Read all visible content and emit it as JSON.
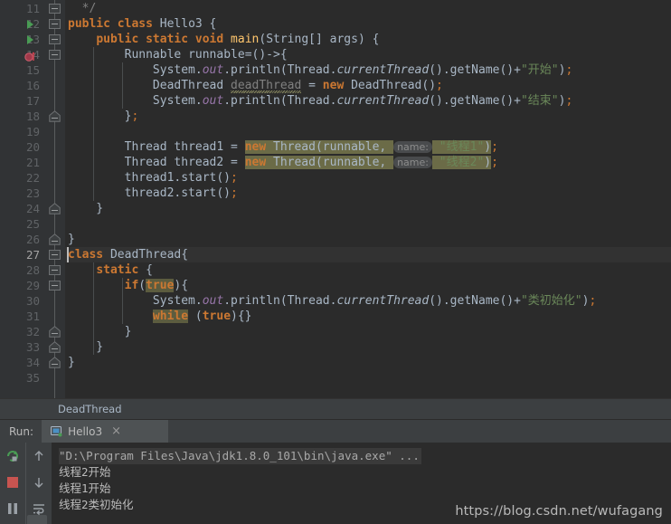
{
  "editor": {
    "first_line": 11,
    "caret_line": 27,
    "lines": [
      {
        "num": 11,
        "indent_guides": 0,
        "fold": "box",
        "tokens": [
          {
            "t": "  ",
            "c": "plain"
          },
          {
            "t": "*/",
            "c": "cmt"
          }
        ]
      },
      {
        "num": 12,
        "gutter": "run-arrow",
        "fold": "box",
        "tokens": [
          {
            "t": "public",
            "c": "kw"
          },
          {
            "t": " ",
            "c": "plain"
          },
          {
            "t": "class",
            "c": "kw"
          },
          {
            "t": " ",
            "c": "plain"
          },
          {
            "t": "Hello3",
            "c": "cls"
          },
          {
            "t": " {",
            "c": "plain"
          }
        ]
      },
      {
        "num": 13,
        "gutter": "run-arrow",
        "fold": "box",
        "tokens": [
          {
            "t": "    ",
            "c": "plain"
          },
          {
            "t": "public",
            "c": "kw"
          },
          {
            "t": " ",
            "c": "plain"
          },
          {
            "t": "static",
            "c": "kw"
          },
          {
            "t": " ",
            "c": "plain"
          },
          {
            "t": "void",
            "c": "kw"
          },
          {
            "t": " ",
            "c": "plain"
          },
          {
            "t": "main",
            "c": "meth"
          },
          {
            "t": "(",
            "c": "plain"
          },
          {
            "t": "String",
            "c": "cls"
          },
          {
            "t": "[] args) {",
            "c": "plain"
          }
        ]
      },
      {
        "num": 14,
        "gutter": "lambda",
        "fold": "box",
        "tokens": [
          {
            "t": "        ",
            "c": "plain"
          },
          {
            "t": "Runnable",
            "c": "cls"
          },
          {
            "t": " runnable=()->{",
            "c": "plain"
          }
        ]
      },
      {
        "num": 15,
        "tokens": [
          {
            "t": "            ",
            "c": "plain"
          },
          {
            "t": "System",
            "c": "cls"
          },
          {
            "t": ".",
            "c": "plain"
          },
          {
            "t": "out",
            "c": "fld"
          },
          {
            "t": ".println(",
            "c": "plain"
          },
          {
            "t": "Thread",
            "c": "cls"
          },
          {
            "t": ".",
            "c": "plain"
          },
          {
            "t": "currentThread",
            "c": "stat"
          },
          {
            "t": "().getName()+",
            "c": "plain"
          },
          {
            "t": "\"开始\"",
            "c": "str"
          },
          {
            "t": ")",
            "c": "plain"
          },
          {
            "t": ";",
            "c": "semi"
          }
        ]
      },
      {
        "num": 16,
        "tokens": [
          {
            "t": "            ",
            "c": "plain"
          },
          {
            "t": "DeadThread",
            "c": "cls"
          },
          {
            "t": " ",
            "c": "plain"
          },
          {
            "t": "deadThread",
            "c": "unused"
          },
          {
            "t": " = ",
            "c": "plain"
          },
          {
            "t": "new",
            "c": "kw"
          },
          {
            "t": " ",
            "c": "plain"
          },
          {
            "t": "DeadThread",
            "c": "cls"
          },
          {
            "t": "()",
            "c": "plain"
          },
          {
            "t": ";",
            "c": "semi"
          }
        ]
      },
      {
        "num": 17,
        "tokens": [
          {
            "t": "            ",
            "c": "plain"
          },
          {
            "t": "System",
            "c": "cls"
          },
          {
            "t": ".",
            "c": "plain"
          },
          {
            "t": "out",
            "c": "fld"
          },
          {
            "t": ".println(",
            "c": "plain"
          },
          {
            "t": "Thread",
            "c": "cls"
          },
          {
            "t": ".",
            "c": "plain"
          },
          {
            "t": "currentThread",
            "c": "stat"
          },
          {
            "t": "().getName()+",
            "c": "plain"
          },
          {
            "t": "\"结束\"",
            "c": "str"
          },
          {
            "t": ")",
            "c": "plain"
          },
          {
            "t": ";",
            "c": "semi"
          }
        ]
      },
      {
        "num": 18,
        "fold": "arrow-up",
        "tokens": [
          {
            "t": "        }",
            "c": "plain"
          },
          {
            "t": ";",
            "c": "semi"
          }
        ]
      },
      {
        "num": 19,
        "tokens": []
      },
      {
        "num": 20,
        "tokens": [
          {
            "t": "        ",
            "c": "plain"
          },
          {
            "t": "Thread",
            "c": "cls"
          },
          {
            "t": " thread1 = ",
            "c": "plain"
          },
          {
            "t": "new",
            "c": "hl-new-kw"
          },
          {
            "t": " Thread(runnable, ",
            "c": "hl-new-plain"
          },
          {
            "t": "name:",
            "c": "hint"
          },
          {
            "t": " ",
            "c": "hl-new-plain"
          },
          {
            "t": "\"线程1\"",
            "c": "hl-new-str"
          },
          {
            "t": ")",
            "c": "hl-new-plain"
          },
          {
            "t": ";",
            "c": "semi"
          }
        ]
      },
      {
        "num": 21,
        "tokens": [
          {
            "t": "        ",
            "c": "plain"
          },
          {
            "t": "Thread",
            "c": "cls"
          },
          {
            "t": " thread2 = ",
            "c": "plain"
          },
          {
            "t": "new",
            "c": "hl-new-kw"
          },
          {
            "t": " Thread(runnable, ",
            "c": "hl-new-plain"
          },
          {
            "t": "name:",
            "c": "hint"
          },
          {
            "t": " ",
            "c": "hl-new-plain"
          },
          {
            "t": "\"线程2\"",
            "c": "hl-new-str"
          },
          {
            "t": ")",
            "c": "hl-new-plain"
          },
          {
            "t": ";",
            "c": "semi"
          }
        ]
      },
      {
        "num": 22,
        "tokens": [
          {
            "t": "        thread1.start()",
            "c": "plain"
          },
          {
            "t": ";",
            "c": "semi"
          }
        ]
      },
      {
        "num": 23,
        "tokens": [
          {
            "t": "        thread2.start()",
            "c": "plain"
          },
          {
            "t": ";",
            "c": "semi"
          }
        ]
      },
      {
        "num": 24,
        "fold": "arrow-up",
        "tokens": [
          {
            "t": "    }",
            "c": "plain"
          }
        ]
      },
      {
        "num": 25,
        "tokens": []
      },
      {
        "num": 26,
        "fold": "arrow-up",
        "tokens": [
          {
            "t": "}",
            "c": "brace"
          }
        ]
      },
      {
        "num": 27,
        "fold": "box",
        "caret": true,
        "tokens": [
          {
            "t": "class",
            "c": "kw"
          },
          {
            "t": " ",
            "c": "plain"
          },
          {
            "t": "DeadThread",
            "c": "cls"
          },
          {
            "t": "{",
            "c": "plain"
          }
        ]
      },
      {
        "num": 28,
        "fold": "box",
        "tokens": [
          {
            "t": "    ",
            "c": "plain"
          },
          {
            "t": "static",
            "c": "kw"
          },
          {
            "t": " {",
            "c": "plain"
          }
        ]
      },
      {
        "num": 29,
        "fold": "box",
        "tokens": [
          {
            "t": "        ",
            "c": "plain"
          },
          {
            "t": "if",
            "c": "kw"
          },
          {
            "t": "(",
            "c": "plain"
          },
          {
            "t": "true",
            "c": "hl-search"
          },
          {
            "t": "){",
            "c": "plain"
          }
        ]
      },
      {
        "num": 30,
        "tokens": [
          {
            "t": "            ",
            "c": "plain"
          },
          {
            "t": "System",
            "c": "cls"
          },
          {
            "t": ".",
            "c": "plain"
          },
          {
            "t": "out",
            "c": "fld"
          },
          {
            "t": ".println(",
            "c": "plain"
          },
          {
            "t": "Thread",
            "c": "cls"
          },
          {
            "t": ".",
            "c": "plain"
          },
          {
            "t": "currentThread",
            "c": "stat"
          },
          {
            "t": "().getName()+",
            "c": "plain"
          },
          {
            "t": "\"类初始化\"",
            "c": "str"
          },
          {
            "t": ")",
            "c": "plain"
          },
          {
            "t": ";",
            "c": "semi"
          }
        ]
      },
      {
        "num": 31,
        "tokens": [
          {
            "t": "            ",
            "c": "plain"
          },
          {
            "t": "while",
            "c": "hl-search"
          },
          {
            "t": " (",
            "c": "plain"
          },
          {
            "t": "true",
            "c": "kw"
          },
          {
            "t": "){}",
            "c": "plain"
          }
        ]
      },
      {
        "num": 32,
        "fold": "arrow-up",
        "tokens": [
          {
            "t": "        }",
            "c": "plain"
          }
        ]
      },
      {
        "num": 33,
        "fold": "arrow-up",
        "tokens": [
          {
            "t": "    }",
            "c": "plain"
          }
        ]
      },
      {
        "num": 34,
        "fold": "arrow-up",
        "tokens": [
          {
            "t": "}",
            "c": "brace"
          }
        ]
      },
      {
        "num": 35,
        "tokens": []
      }
    ]
  },
  "breadcrumb": {
    "text": "DeadThread"
  },
  "run_panel": {
    "label": "Run:",
    "tab_title": "Hello3",
    "tab_close": "×",
    "toolbar_left": [
      {
        "name": "rerun-icon",
        "title": "Rerun"
      },
      {
        "name": "stop-icon",
        "title": "Stop"
      },
      {
        "name": "pause-icon",
        "title": "Pause Output"
      }
    ],
    "toolbar_right": [
      {
        "name": "arrow-up-icon",
        "title": "Up the stack trace"
      },
      {
        "name": "arrow-down-icon",
        "title": "Down the stack trace"
      },
      {
        "name": "soft-wrap-icon",
        "title": "Soft-Wrap"
      }
    ],
    "console_lines": [
      {
        "text": "\"D:\\Program Files\\Java\\jdk1.8.0_101\\bin\\java.exe\" ...",
        "style": "cmdline"
      },
      {
        "text": "线程2开始",
        "style": "out"
      },
      {
        "text": "线程1开始",
        "style": "out"
      },
      {
        "text": "线程2类初始化",
        "style": "out"
      }
    ]
  },
  "watermark": {
    "text": "https://blog.csdn.net/wufagang"
  },
  "colors": {
    "editor_bg": "#2b2b2b",
    "gutter_bg": "#313335",
    "panel_bg": "#3c3f41",
    "keyword": "#cc7832",
    "string": "#6a8759",
    "field": "#9876aa",
    "text": "#a9b7c6",
    "line_number": "#606366",
    "run_green": "#499c54",
    "stop_red": "#c75450",
    "highlight_search": "#5c5c3f",
    "highlight_new": "#6b6b47"
  }
}
